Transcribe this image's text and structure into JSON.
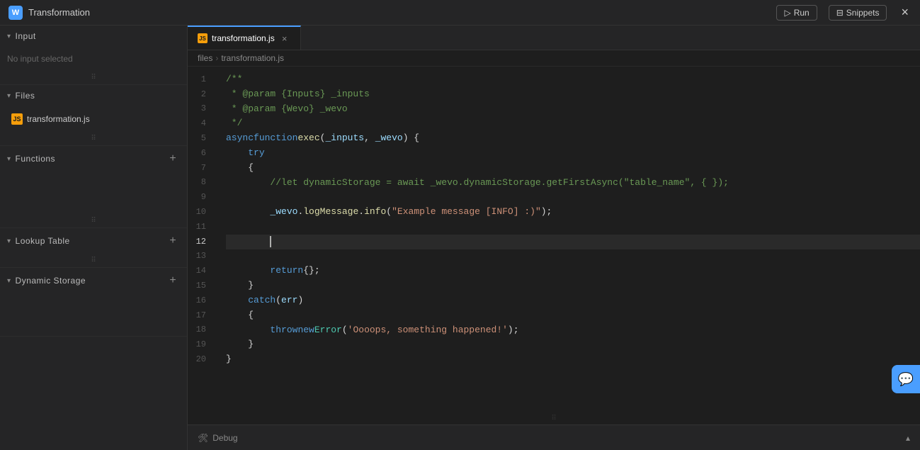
{
  "titleBar": {
    "title": "Transformation",
    "runLabel": "Run",
    "snippetsLabel": "Snippets",
    "logoText": "W"
  },
  "sidebar": {
    "inputSection": {
      "label": "Input",
      "noInputText": "No input selected"
    },
    "filesSection": {
      "label": "Files",
      "files": [
        {
          "name": "transformation.js",
          "iconText": "JS"
        }
      ]
    },
    "functionsSection": {
      "label": "Functions"
    },
    "lookupTableSection": {
      "label": "Lookup Table"
    },
    "dynamicStorageSection": {
      "label": "Dynamic Storage"
    }
  },
  "editor": {
    "tab": {
      "filename": "transformation.js",
      "iconText": "JS"
    },
    "breadcrumb": {
      "path": "files",
      "filename": "transformation.js"
    },
    "debugLabel": "Debug"
  },
  "icons": {
    "chevronDown": "▾",
    "chevronRight": "▸",
    "plus": "+",
    "close": "×",
    "run": "▷",
    "snippets": "⊟",
    "debug": "🛠",
    "chevronUp": "▴",
    "chat": "💬",
    "drag": "⠿"
  }
}
